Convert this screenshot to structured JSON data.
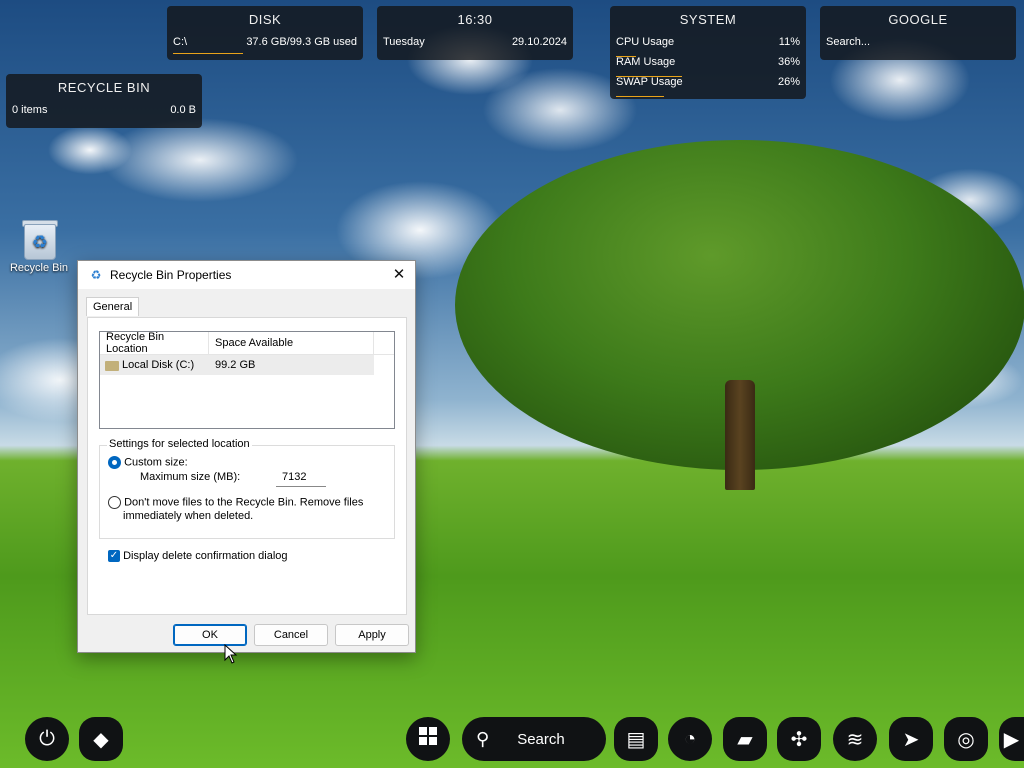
{
  "widgets": {
    "disk": {
      "title": "DISK",
      "drive": "C:\\",
      "usage": "37.6 GB/99.3 GB used",
      "fill": 0.38
    },
    "clock": {
      "time": "16:30",
      "day": "Tuesday",
      "date": "29.10.2024"
    },
    "system": {
      "title": "SYSTEM",
      "rows": [
        {
          "label": "CPU Usage",
          "value": "11%",
          "fill": 0.11
        },
        {
          "label": "RAM Usage",
          "value": "36%",
          "fill": 0.36
        },
        {
          "label": "SWAP Usage",
          "value": "26%",
          "fill": 0.26
        }
      ]
    },
    "google": {
      "title": "GOOGLE",
      "placeholder": "Search..."
    },
    "recycle": {
      "title": "RECYCLE BIN",
      "items": "0 items",
      "size": "0.0 B"
    }
  },
  "desktop": {
    "recycle_bin_label": "Recycle Bin"
  },
  "dialog": {
    "title": "Recycle Bin Properties",
    "close_glyph": "✕",
    "tab_general": "General",
    "columns": [
      "Recycle Bin Location",
      "Space Available"
    ],
    "locations": [
      {
        "name": "Local Disk (C:)",
        "space": "99.2 GB"
      }
    ],
    "settings_label": "Settings for selected location",
    "custom_size_label": "Custom size:",
    "max_size_label": "Maximum size (MB):",
    "max_size_value": "7132",
    "dont_move_label_line1": "Don't move files to the Recycle Bin. Remove files",
    "dont_move_label_line2": "immediately when deleted.",
    "confirm_label": "Display delete confirmation dialog",
    "buttons": {
      "ok": "OK",
      "cancel": "Cancel",
      "apply": "Apply"
    }
  },
  "taskbar": {
    "search_label": "Search",
    "icons": [
      "power-icon",
      "app-icon",
      "windows-start-icon",
      "search-icon",
      "media-player-icon",
      "edge-icon",
      "folder-icon",
      "puzzle-icon",
      "spotify-icon",
      "telegram-icon",
      "instagram-icon",
      "youtube-icon"
    ]
  },
  "colors": {
    "accent": "#0067c0",
    "widget_bar": "#e8a31a",
    "widget_bg": "#14161a"
  }
}
